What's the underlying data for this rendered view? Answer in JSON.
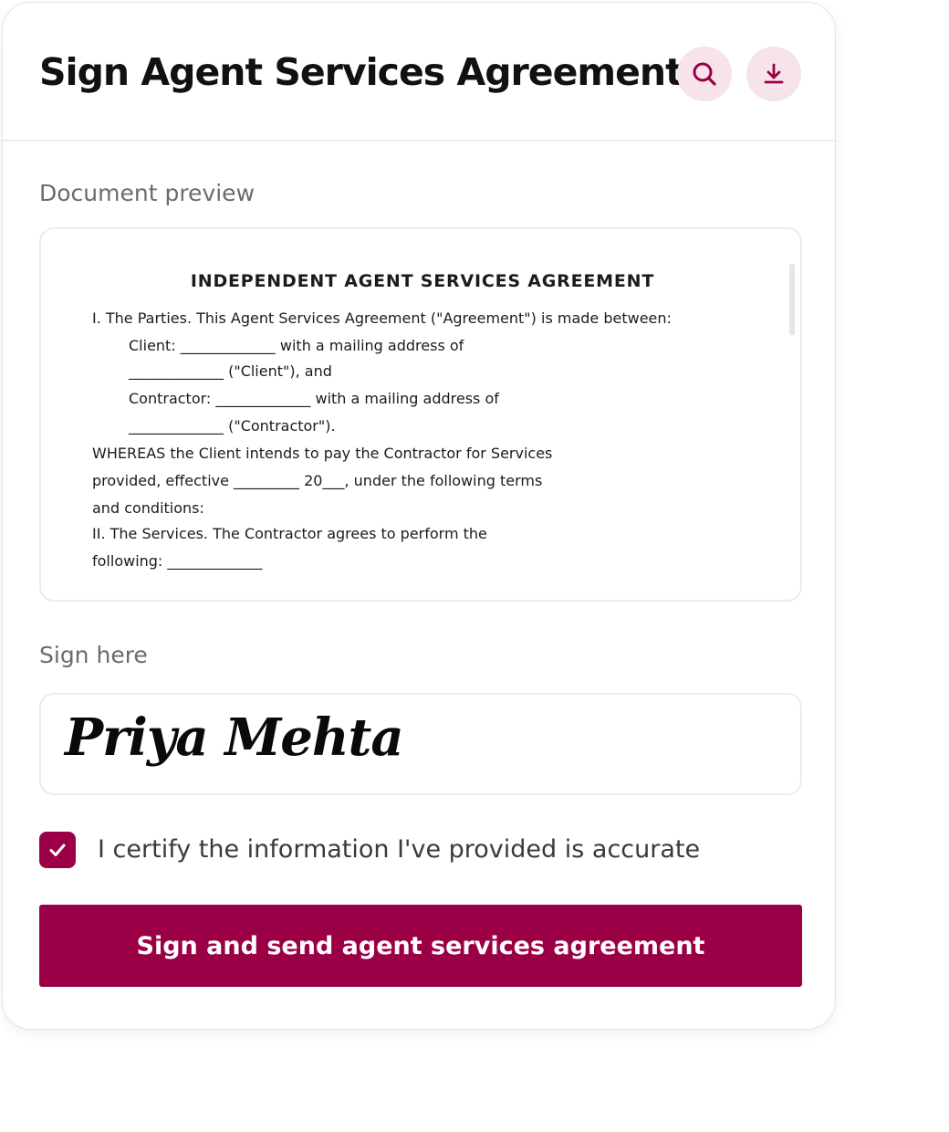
{
  "header": {
    "title": "Sign Agent Services Agreement",
    "search_icon": "search-icon",
    "download_icon": "download-icon"
  },
  "preview": {
    "label": "Document preview",
    "doc_title": "INDEPENDENT AGENT SERVICES AGREEMENT",
    "lines": [
      "I. The Parties. This Agent Services Agreement (\"Agreement\") is made between:",
      "Client: _____________ with a mailing address of",
      "_____________ (\"Client\"), and",
      "Contractor: _____________ with a mailing address of",
      "_____________ (\"Contractor\").",
      "WHEREAS the Client intends to pay the Contractor for Services",
      "provided, effective _________ 20___, under the following terms",
      "and conditions:",
      "II. The Services. The Contractor agrees to perform the",
      "following: _____________"
    ]
  },
  "sign": {
    "label": "Sign here",
    "signature": "Priya Mehta"
  },
  "certify": {
    "checked": true,
    "label": "I certify the information I've provided is accurate"
  },
  "submit": {
    "label": "Sign and send agent services agreement"
  },
  "colors": {
    "brand": "#9b0047",
    "icon_bg": "#f7e3ea"
  }
}
